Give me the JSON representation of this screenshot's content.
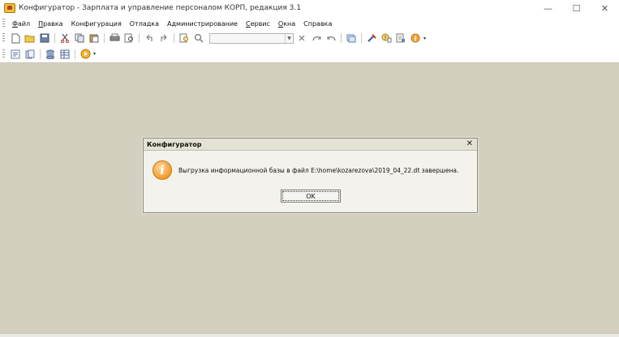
{
  "window": {
    "title": "Конфигуратор - Зарплата и управление персоналом КОРП, редакция 3.1",
    "controls": {
      "minimize": "—",
      "maximize": "☐",
      "close": "✕"
    }
  },
  "menu": [
    {
      "name": "file",
      "underline": "Ф",
      "rest": "айл"
    },
    {
      "name": "edit",
      "underline": "П",
      "rest": "равка"
    },
    {
      "name": "configuration",
      "underline": "",
      "rest": "Конфигурация"
    },
    {
      "name": "debug",
      "underline": "",
      "rest": "Отладка"
    },
    {
      "name": "administration",
      "underline": "",
      "rest": "Администрирование"
    },
    {
      "name": "service",
      "underline": "С",
      "rest": "ервис"
    },
    {
      "name": "windows",
      "underline": "О",
      "rest": "кна"
    },
    {
      "name": "help",
      "underline": "",
      "rest": "Справка"
    }
  ],
  "toolbar1": {
    "icons": [
      "new-document-icon",
      "open-folder-icon",
      "save-icon",
      "cut-icon",
      "copy-icon",
      "paste-icon",
      "print-icon",
      "print-preview-icon",
      "undo-icon",
      "redo-icon",
      "find-icon",
      "zoom-icon",
      "search-combo",
      "find-next-icon",
      "find-prev-icon",
      "window-icon",
      "tools-icon",
      "help-icon",
      "syntax-icon",
      "info-icon"
    ]
  },
  "toolbar2": {
    "icons": [
      "config-open-icon",
      "config-db-icon",
      "database-icon",
      "table-icon",
      "run-debug-icon"
    ]
  },
  "dialog": {
    "title": "Конфигуратор",
    "close": "✕",
    "message": "Выгрузка информационной базы в файл E:\\home\\kozarezova\\2019_04_22.dt завершена.",
    "ok_label": "OK",
    "icon_glyph": "i"
  }
}
